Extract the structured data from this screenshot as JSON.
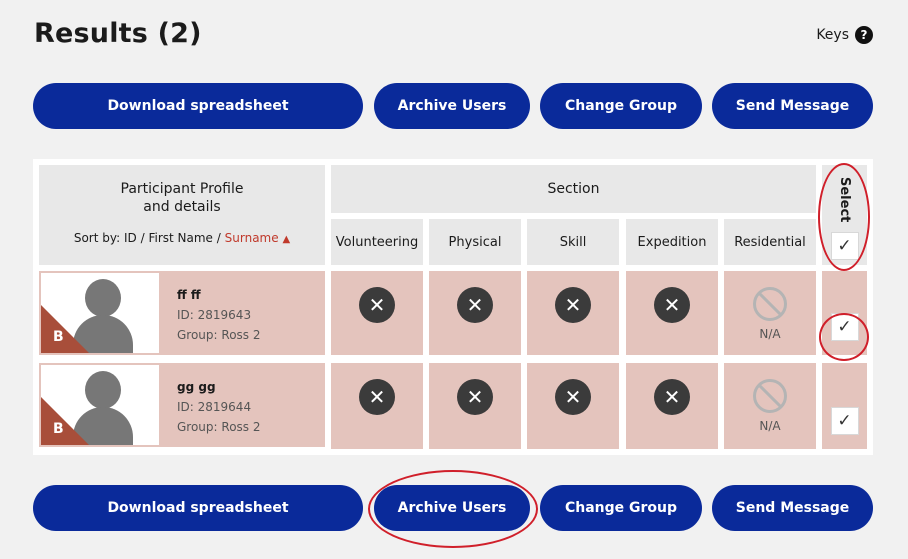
{
  "header": {
    "title": "Results (2)",
    "keys_label": "Keys",
    "keys_icon": "question-icon",
    "keys_glyph": "?"
  },
  "actions": {
    "download": "Download spreadsheet",
    "archive": "Archive Users",
    "change_group": "Change Group",
    "send_message": "Send Message"
  },
  "table": {
    "profile_header_line1": "Participant Profile",
    "profile_header_line2": "and details",
    "sort_prefix": "Sort by:",
    "sort_id": "ID",
    "sort_first": "First Name",
    "sort_surname": "Surname",
    "sort_sep": "/",
    "sort_arrow": "▲",
    "section_header": "Section",
    "select_header": "Select",
    "columns": [
      "Volunteering",
      "Physical",
      "Skill",
      "Expedition",
      "Residential"
    ],
    "check_glyph": "✓",
    "x_glyph": "✕",
    "rows": [
      {
        "name": "ff ff",
        "id": "ID: 2819643",
        "group": "Group: Ross 2",
        "badge": "B",
        "statuses": [
          "not-complete",
          "not-complete",
          "not-complete",
          "not-complete",
          "n/a"
        ],
        "na_label": "N/A",
        "selected": true
      },
      {
        "name": "gg gg",
        "id": "ID: 2819644",
        "group": "Group: Ross 2",
        "badge": "B",
        "statuses": [
          "not-complete",
          "not-complete",
          "not-complete",
          "not-complete",
          "n/a"
        ],
        "na_label": "N/A",
        "selected": true
      }
    ]
  },
  "colors": {
    "primary_button": "#0a2a9a",
    "row_bg": "#e4c4bd",
    "sort_active": "#c0392b",
    "badge": "#a84e3a",
    "annotation": "#d01f2a"
  }
}
